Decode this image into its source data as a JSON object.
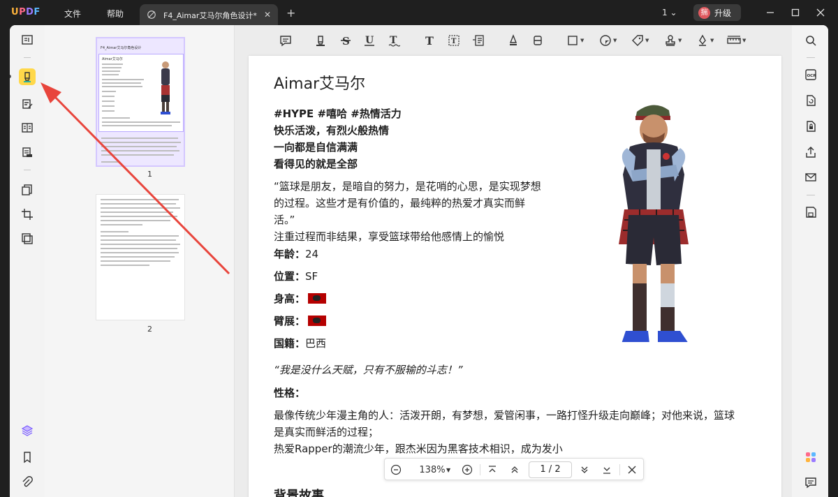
{
  "titlebar": {
    "logo": "UPDF",
    "menu": [
      "文件",
      "帮助"
    ],
    "tab_title": "F4_Aimar艾马尔角色设计*",
    "tab_close": "✕",
    "new_tab": "+",
    "page_count": "1",
    "upgrade_avatar": "揣",
    "upgrade_label": "升级"
  },
  "thumbnails": {
    "pages": [
      {
        "number": "1",
        "title": "F4_Aimar艾马尔角色设计",
        "heading": "Aimar艾马尔"
      },
      {
        "number": "2"
      }
    ]
  },
  "document": {
    "title": "Aimar艾马尔",
    "tags": "#HYPE #嘻哈 #热情活力",
    "bold_lines": [
      "快乐活泼，有烈火般热情",
      "一向都是自信满满",
      "看得见的就是全部"
    ],
    "quote_lines": [
      "“篮球是朋友，是暗自的努力，是花哨的心思，是实现梦想",
      "的过程。这些才是有价值的，最纯粹的热爱才真实而鲜",
      "活。”"
    ],
    "note": "注重过程而非结果，享受篮球带给他感情上的愉悦",
    "age_label": "年龄：",
    "age_value": "24",
    "position_label": "位置：",
    "position_value": "SF",
    "height_label": "身高：",
    "wingspan_label": "臂展：",
    "nationality_label": "国籍：",
    "nationality_value": "巴西",
    "motto": "“我是没什么天赋，只有不服输的斗志！”",
    "personality_label": "性格：",
    "personality_lines": [
      "最像传统少年漫主角的人：活泼开朗，有梦想，爱管闲事，一路打怪升级走向巅峰；对他来说，篮球",
      "是真实而鲜活的过程；",
      "热爱Rapper的潮流少年，跟杰米因为黑客技术相识，成为发小"
    ],
    "next_heading": "背景故事"
  },
  "zoombar": {
    "zoom": "138%",
    "current_page": "1",
    "page_sep": "/",
    "total_pages": "2"
  },
  "colors": {
    "accent": "#ffd84a",
    "arrow": "#e8453c",
    "thumb_selected": "#ede7ff",
    "badge": "#b50000"
  }
}
